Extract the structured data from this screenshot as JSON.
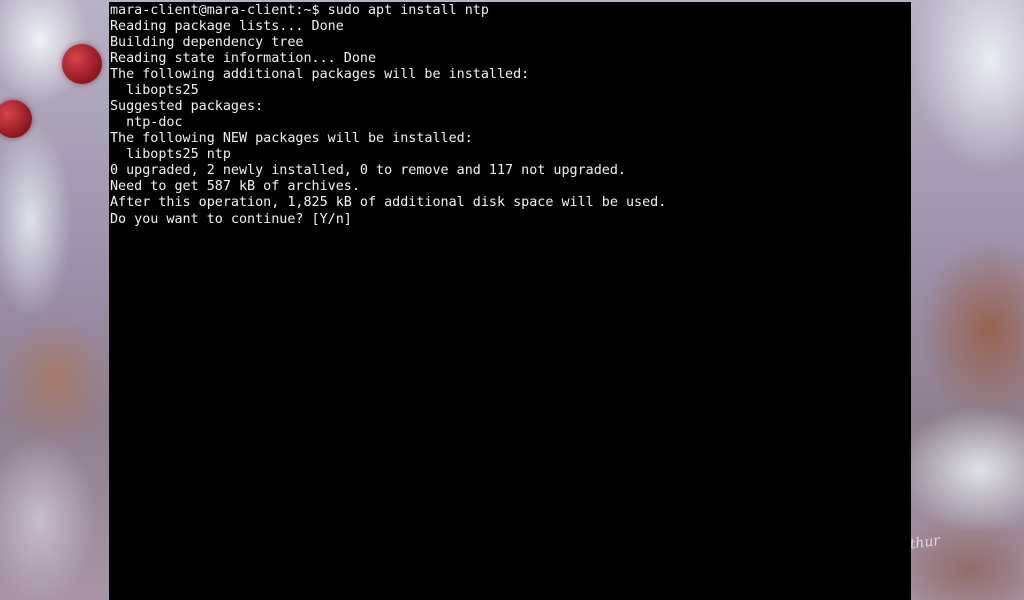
{
  "terminal": {
    "lines": [
      "mara-client@mara-client:~$ sudo apt install ntp",
      "Reading package lists... Done",
      "Building dependency tree",
      "Reading state information... Done",
      "The following additional packages will be installed:",
      "  libopts25",
      "Suggested packages:",
      "  ntp-doc",
      "The following NEW packages will be installed:",
      "  libopts25 ntp",
      "0 upgraded, 2 newly installed, 0 to remove and 117 not upgraded.",
      "Need to get 587 kB of archives.",
      "After this operation, 1,825 kB of additional disk space will be used.",
      "Do you want to continue? [Y/n]"
    ]
  },
  "wallpaper": {
    "signature": "Rethur"
  }
}
